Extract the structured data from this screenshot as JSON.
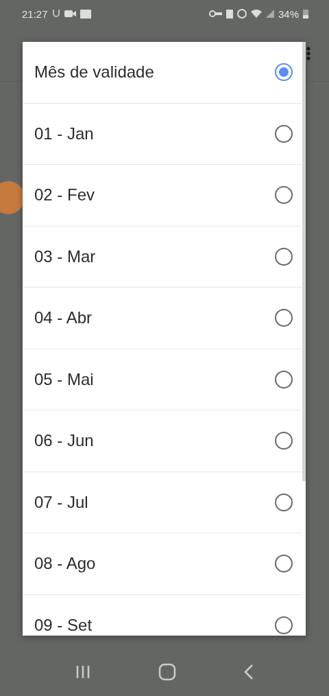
{
  "status_bar": {
    "time": "21:27",
    "battery": "34%"
  },
  "dialog": {
    "options": [
      {
        "label": "Mês de validade",
        "selected": true
      },
      {
        "label": "01 - Jan",
        "selected": false
      },
      {
        "label": "02 - Fev",
        "selected": false
      },
      {
        "label": "03 - Mar",
        "selected": false
      },
      {
        "label": "04 - Abr",
        "selected": false
      },
      {
        "label": "05 - Mai",
        "selected": false
      },
      {
        "label": "06 - Jun",
        "selected": false
      },
      {
        "label": "07 - Jul",
        "selected": false
      },
      {
        "label": "08 - Ago",
        "selected": false
      },
      {
        "label": "09 - Set",
        "selected": false
      }
    ]
  }
}
